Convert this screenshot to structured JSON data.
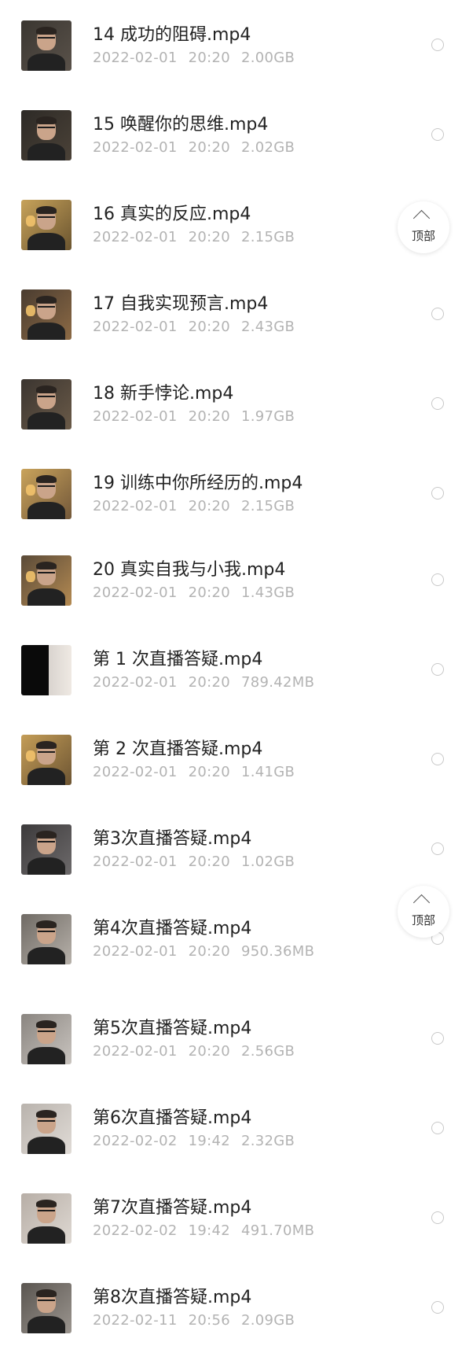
{
  "files": [
    {
      "title": "14 成功的阻碍.mp4",
      "date": "2022-02-01",
      "time": "20:20",
      "size": "2.00GB"
    },
    {
      "title": "15 唤醒你的思维.mp4",
      "date": "2022-02-01",
      "time": "20:20",
      "size": "2.02GB"
    },
    {
      "title": "16 真实的反应.mp4",
      "date": "2022-02-01",
      "time": "20:20",
      "size": "2.15GB"
    },
    {
      "title": "17 自我实现预言.mp4",
      "date": "2022-02-01",
      "time": "20:20",
      "size": "2.43GB"
    },
    {
      "title": "18 新手悖论.mp4",
      "date": "2022-02-01",
      "time": "20:20",
      "size": "1.97GB"
    },
    {
      "title": "19 训练中你所经历的.mp4",
      "date": "2022-02-01",
      "time": "20:20",
      "size": "2.15GB"
    },
    {
      "title": "20 真实自我与小我.mp4",
      "date": "2022-02-01",
      "time": "20:20",
      "size": "1.43GB"
    },
    {
      "title": "第 1 次直播答疑.mp4",
      "date": "2022-02-01",
      "time": "20:20",
      "size": "789.42MB"
    },
    {
      "title": "第 2 次直播答疑.mp4",
      "date": "2022-02-01",
      "time": "20:20",
      "size": "1.41GB"
    },
    {
      "title": "第3次直播答疑.mp4",
      "date": "2022-02-01",
      "time": "20:20",
      "size": "1.02GB"
    },
    {
      "title": "第4次直播答疑.mp4",
      "date": "2022-02-01",
      "time": "20:20",
      "size": "950.36MB"
    },
    {
      "title": "第5次直播答疑.mp4",
      "date": "2022-02-01",
      "time": "20:20",
      "size": "2.56GB"
    },
    {
      "title": "第6次直播答疑.mp4",
      "date": "2022-02-02",
      "time": "19:42",
      "size": "2.32GB"
    },
    {
      "title": "第7次直播答疑.mp4",
      "date": "2022-02-02",
      "time": "19:42",
      "size": "491.70MB"
    },
    {
      "title": "第8次直播答疑.mp4",
      "date": "2022-02-11",
      "time": "20:56",
      "size": "2.09GB"
    }
  ],
  "scroll_top_buttons": [
    {
      "label": "顶部",
      "icon": "chevron-up-icon"
    },
    {
      "label": "顶部",
      "icon": "chevron-up-icon"
    }
  ],
  "colors": {
    "title_text": "#222222",
    "meta_text": "#b3b3b3",
    "radio_border": "#c8c8c8",
    "background": "#ffffff"
  }
}
